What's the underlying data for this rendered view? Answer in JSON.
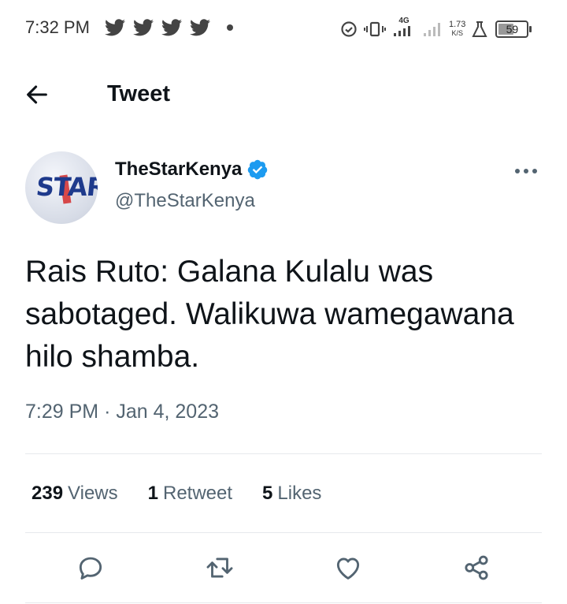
{
  "status_bar": {
    "time": "7:32 PM",
    "notification_icons": [
      "twitter-bird-icon",
      "twitter-bird-icon",
      "twitter-bird-icon",
      "twitter-bird-icon"
    ],
    "network_type": "4G",
    "net_speed": "1.73",
    "net_speed_unit": "K/S",
    "battery_level": "59",
    "battery_fraction": 0.59
  },
  "header": {
    "title": "Tweet"
  },
  "author": {
    "display_name": "TheStarKenya",
    "handle": "@TheStarKenya",
    "avatar_logo_text": "STAR",
    "verified": true
  },
  "tweet": {
    "text": "Rais Ruto: Galana Kulalu was sabotaged. Walikuwa wamegawana hilo shamba.",
    "time": "7:29 PM",
    "separator": "·",
    "date": "Jan 4, 2023"
  },
  "stats": {
    "views_count": "239",
    "views_label": "Views",
    "retweets_count": "1",
    "retweets_label": "Retweet",
    "likes_count": "5",
    "likes_label": "Likes"
  },
  "actions": [
    "reply-icon",
    "retweet-icon",
    "like-icon",
    "share-icon"
  ],
  "colors": {
    "verified_blue": "#1d9bf0",
    "secondary_text": "#536471",
    "primary_text": "#0f1419"
  }
}
